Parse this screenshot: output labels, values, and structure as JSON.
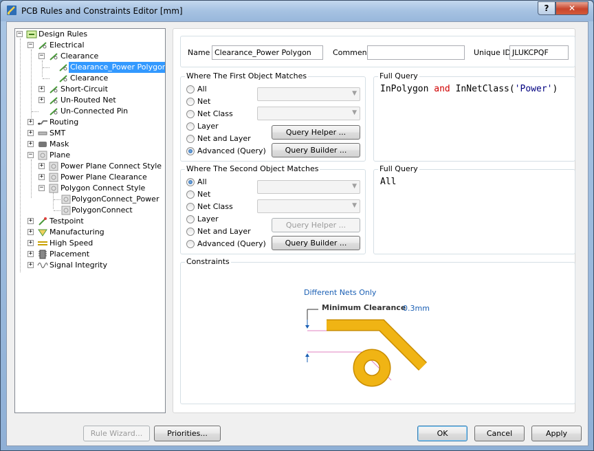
{
  "window": {
    "title": "PCB Rules and Constraints Editor [mm]",
    "help_label": "?",
    "close_label": "✕"
  },
  "tree": {
    "items": [
      {
        "label": "Design Rules"
      },
      {
        "label": "Electrical"
      },
      {
        "label": "Clearance"
      },
      {
        "label": "Clearance_Power Polygon",
        "selected": true
      },
      {
        "label": "Clearance"
      },
      {
        "label": "Short-Circuit"
      },
      {
        "label": "Un-Routed Net"
      },
      {
        "label": "Un-Connected Pin"
      },
      {
        "label": "Routing"
      },
      {
        "label": "SMT"
      },
      {
        "label": "Mask"
      },
      {
        "label": "Plane"
      },
      {
        "label": "Power Plane Connect Style"
      },
      {
        "label": "Power Plane Clearance"
      },
      {
        "label": "Polygon Connect Style"
      },
      {
        "label": "PolygonConnect_Power"
      },
      {
        "label": "PolygonConnect"
      },
      {
        "label": "Testpoint"
      },
      {
        "label": "Manufacturing"
      },
      {
        "label": "High Speed"
      },
      {
        "label": "Placement"
      },
      {
        "label": "Signal Integrity"
      }
    ]
  },
  "rule": {
    "name_label": "Name",
    "name_value": "Clearance_Power Polygon",
    "comment_label": "Comment",
    "comment_value": "",
    "uid_label": "Unique ID",
    "uid_value": "JLUKCPQF"
  },
  "first_match": {
    "title": "Where The First Object Matches",
    "options": [
      "All",
      "Net",
      "Net Class",
      "Layer",
      "Net and Layer",
      "Advanced (Query)"
    ],
    "selected": "Advanced (Query)",
    "query_helper_label": "Query Helper ...",
    "query_builder_label": "Query Builder ...",
    "full_query_title": "Full Query",
    "query": {
      "fn1": "InPolygon",
      "op": "and",
      "fn2": "InNetClass",
      "lp": "(",
      "arg": "'Power'",
      "rp": ")"
    }
  },
  "second_match": {
    "title": "Where The Second Object Matches",
    "options": [
      "All",
      "Net",
      "Net Class",
      "Layer",
      "Net and Layer",
      "Advanced (Query)"
    ],
    "selected": "All",
    "query_helper_label": "Query Helper ...",
    "query_builder_label": "Query Builder ...",
    "full_query_title": "Full Query",
    "query_text": "All"
  },
  "constraints": {
    "title": "Constraints",
    "nets_label": "Different Nets Only",
    "min_clearance_label": "Minimum Clearance",
    "min_clearance_value": "0.3mm",
    "colors": {
      "copper": "#f0b414",
      "copper_edge": "#c88c00",
      "link": "#1a5fb4",
      "pink": "#e080c0"
    }
  },
  "footer": {
    "rule_wizard_label": "Rule Wizard...",
    "priorities_label": "Priorities...",
    "ok_label": "OK",
    "cancel_label": "Cancel",
    "apply_label": "Apply"
  }
}
